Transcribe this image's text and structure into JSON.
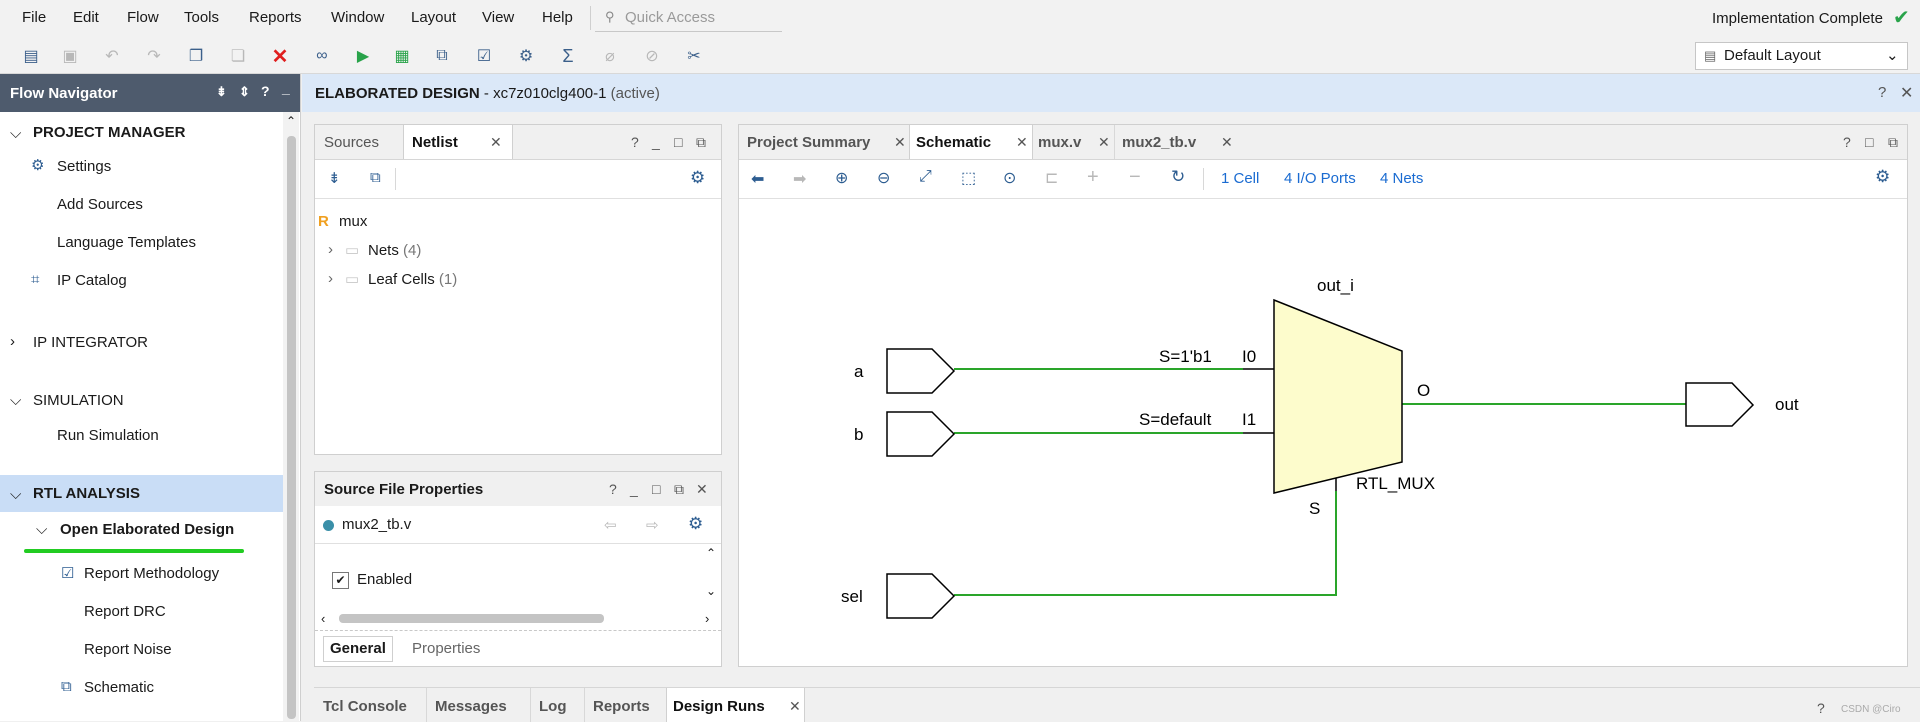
{
  "menubar": {
    "items": [
      "File",
      "Edit",
      "Flow",
      "Tools",
      "Reports",
      "Window",
      "Layout",
      "View",
      "Help"
    ],
    "quick_access_placeholder": "Quick Access",
    "status": "Implementation Complete"
  },
  "toolbar": {
    "layout_select": "Default Layout"
  },
  "flow_navigator": {
    "title": "Flow Navigator",
    "project_manager": {
      "label": "PROJECT MANAGER",
      "settings": "Settings",
      "add_sources": "Add Sources",
      "language_templates": "Language Templates",
      "ip_catalog": "IP Catalog"
    },
    "ip_integrator": "IP INTEGRATOR",
    "simulation": {
      "label": "SIMULATION",
      "run": "Run Simulation"
    },
    "rtl_analysis": {
      "label": "RTL ANALYSIS",
      "open_elaborated": "Open Elaborated Design",
      "report_methodology": "Report Methodology",
      "report_drc": "Report DRC",
      "report_noise": "Report Noise",
      "schematic": "Schematic"
    }
  },
  "elaborated": {
    "title": "ELABORATED DESIGN",
    "part": " - xc7z010clg400-1",
    "state": "(active)"
  },
  "netlist_panel": {
    "tab_sources": "Sources",
    "tab_netlist": "Netlist",
    "root": "mux",
    "nets_label": "Nets",
    "nets_count": "(4)",
    "leaf_label": "Leaf Cells",
    "leaf_count": "(1)"
  },
  "source_props": {
    "title": "Source File Properties",
    "file": "mux2_tb.v",
    "enabled": "Enabled",
    "tab_general": "General",
    "tab_properties": "Properties"
  },
  "schematic_panel": {
    "tabs": [
      "Project Summary",
      "Schematic",
      "mux.v",
      "mux2_tb.v"
    ],
    "cells": "1 Cell",
    "io_ports": "4 I/O Ports",
    "nets": "4 Nets"
  },
  "schematic": {
    "inputs": [
      "a",
      "b",
      "sel"
    ],
    "output": "out",
    "cell_name": "out_i",
    "cell_type": "RTL_MUX",
    "pin_i0": "I0",
    "pin_i1": "I1",
    "pin_o": "O",
    "pin_s": "S",
    "net_a": "S=1'b1",
    "net_b": "S=default",
    "wire_color": "#2aa52a",
    "mux_fill": "#fdfccc"
  },
  "bottom_tabs": [
    "Tcl Console",
    "Messages",
    "Log",
    "Reports",
    "Design Runs"
  ],
  "watermark": "CSDN @Ciro",
  "colors": {
    "accent": "#2d6db5",
    "nav_header": "#4e5b6d",
    "selected_row": "#c9ddf6",
    "underline": "#22cc22",
    "check": "#29a34a",
    "error_red": "#e01e1e"
  }
}
